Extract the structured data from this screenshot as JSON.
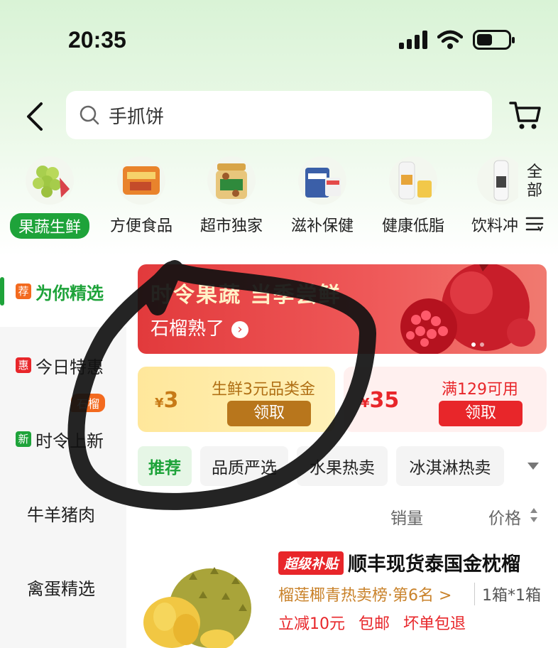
{
  "status": {
    "time": "20:35"
  },
  "search": {
    "text": "手抓饼"
  },
  "categories": [
    {
      "label": "果蔬生鲜",
      "active": true
    },
    {
      "label": "方便食品"
    },
    {
      "label": "超市独家"
    },
    {
      "label": "滋补保健"
    },
    {
      "label": "健康低脂"
    },
    {
      "label": "饮料冲"
    }
  ],
  "category_all": "全部",
  "sidebar": {
    "items": [
      {
        "tag": "荐",
        "label": "为你精选"
      },
      {
        "tag": "惠",
        "label": "今日特惠"
      },
      {
        "tag": "新",
        "label": "时令上新",
        "badge": "石榴"
      },
      {
        "label": "牛羊猪肉"
      },
      {
        "label": "禽蛋精选"
      }
    ]
  },
  "banner": {
    "title": "时令果蔬 当季尝鲜",
    "subtitle": "石榴熟了"
  },
  "coupons": [
    {
      "amount": "3",
      "currency": "¥",
      "desc": "生鲜3元品类金",
      "button": "领取"
    },
    {
      "amount": "35",
      "currency": "¥",
      "desc": "满129可用",
      "button": "领取"
    }
  ],
  "tabs": [
    "推荐",
    "品质严选",
    "水果热卖",
    "冰淇淋热卖"
  ],
  "sort": {
    "sales": "销量",
    "price": "价格"
  },
  "product": {
    "badge": "超级补贴",
    "title": "顺丰现货泰国金枕榴",
    "rank": "榴莲椰青热卖榜·第6名 >",
    "spec": "1箱*1箱",
    "promos": [
      "立减10元",
      "包邮",
      "坏单包退"
    ]
  },
  "colors": {
    "brand_green": "#1ea33a",
    "red": "#e8262a",
    "orange": "#f36a1f"
  }
}
